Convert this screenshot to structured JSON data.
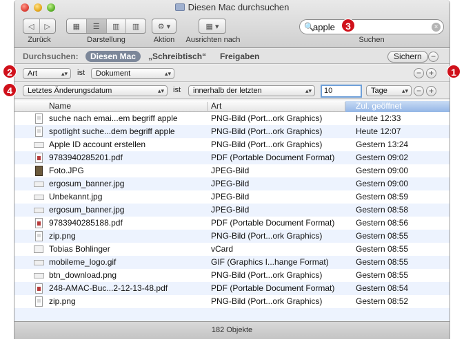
{
  "window": {
    "title": "Diesen Mac durchsuchen"
  },
  "toolbar": {
    "back_label": "Zurück",
    "view_label": "Darstellung",
    "action_label": "Aktion",
    "arrange_label": "Ausrichten nach",
    "search_label": "Suchen",
    "search_value": "apple"
  },
  "scope": {
    "label": "Durchsuchen:",
    "items": [
      "Diesen Mac",
      "„Schreibtisch“",
      "Freigaben"
    ],
    "save_label": "Sichern"
  },
  "criteria": [
    {
      "attribute": "Art",
      "operator": "ist",
      "value": "Dokument"
    },
    {
      "attribute": "Letztes Änderungsdatum",
      "operator": "ist",
      "value": "innerhalb der letzten",
      "amount": "10",
      "unit": "Tage"
    }
  ],
  "annotations": [
    "1",
    "2",
    "3",
    "4"
  ],
  "table": {
    "headers": [
      "Name",
      "Art",
      "Zul. geöffnet"
    ],
    "rows": [
      {
        "icon": "png",
        "name": "suche nach emai...em begriff apple",
        "kind": "PNG-Bild (Port...ork Graphics)",
        "opened": "Heute 12:33"
      },
      {
        "icon": "png",
        "name": "spotlight suche...dem begriff apple",
        "kind": "PNG-Bild (Port...ork Graphics)",
        "opened": "Heute 12:07"
      },
      {
        "icon": "web",
        "name": "Apple ID account erstellen",
        "kind": "PNG-Bild (Port...ork Graphics)",
        "opened": "Gestern 13:24"
      },
      {
        "icon": "pdf",
        "name": "9783940285201.pdf",
        "kind": "PDF (Portable Document Format)",
        "opened": "Gestern 09:02"
      },
      {
        "icon": "photo",
        "name": "Foto.JPG",
        "kind": "JPEG-Bild",
        "opened": "Gestern 09:00"
      },
      {
        "icon": "web",
        "name": "ergosum_banner.jpg",
        "kind": "JPEG-Bild",
        "opened": "Gestern 09:00"
      },
      {
        "icon": "web",
        "name": "Unbekannt.jpg",
        "kind": "JPEG-Bild",
        "opened": "Gestern 08:59"
      },
      {
        "icon": "web",
        "name": "ergosum_banner.jpg",
        "kind": "JPEG-Bild",
        "opened": "Gestern 08:58"
      },
      {
        "icon": "pdf",
        "name": "9783940285188.pdf",
        "kind": "PDF (Portable Document Format)",
        "opened": "Gestern 08:56"
      },
      {
        "icon": "png",
        "name": "zip.png",
        "kind": "PNG-Bild (Port...ork Graphics)",
        "opened": "Gestern 08:55"
      },
      {
        "icon": "vcard",
        "name": "Tobias Bohlinger",
        "kind": "vCard",
        "opened": "Gestern 08:55"
      },
      {
        "icon": "web",
        "name": "mobileme_logo.gif",
        "kind": "GIF (Graphics I...hange Format)",
        "opened": "Gestern 08:55"
      },
      {
        "icon": "web",
        "name": "btn_download.png",
        "kind": "PNG-Bild (Port...ork Graphics)",
        "opened": "Gestern 08:55"
      },
      {
        "icon": "pdf",
        "name": "248-AMAC-Buc...2-12-13-48.pdf",
        "kind": "PDF (Portable Document Format)",
        "opened": "Gestern 08:54"
      },
      {
        "icon": "png",
        "name": "zip.png",
        "kind": "PNG-Bild (Port...ork Graphics)",
        "opened": "Gestern 08:52"
      }
    ]
  },
  "status": {
    "text": "182 Objekte"
  }
}
